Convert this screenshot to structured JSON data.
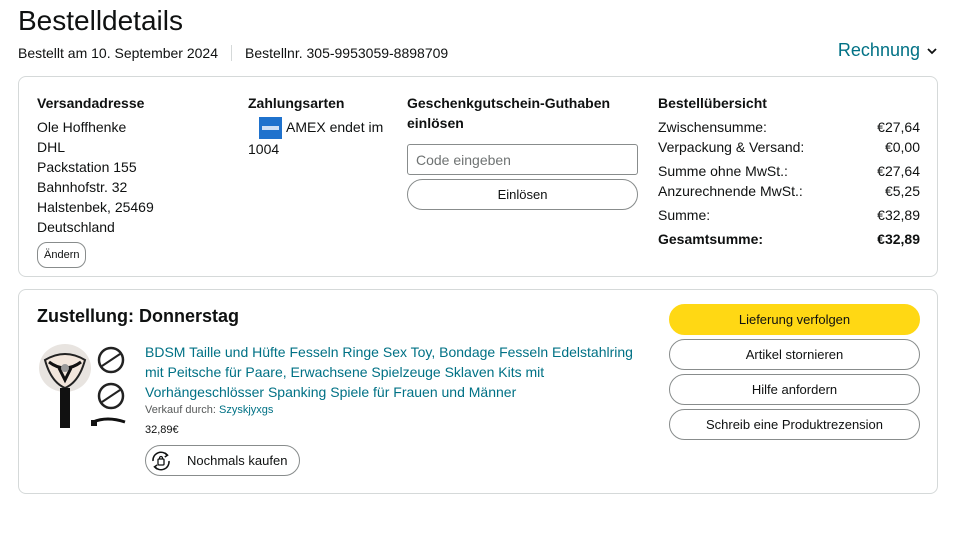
{
  "header": {
    "title": "Bestelldetails",
    "order_date": "Bestellt am 10. September 2024",
    "order_number": "Bestellnr. 305-9953059-8898709",
    "invoice_label": "Rechnung"
  },
  "address": {
    "heading": "Versandadresse",
    "lines": [
      "Ole Hoffhenke",
      "DHL",
      "Packstation 155",
      "Bahnhofstr. 32",
      "Halstenbek, 25469",
      "Deutschland"
    ],
    "change_label": "Ändern"
  },
  "payment": {
    "heading": "Zahlungsarten",
    "card_text": "AMEX endet im",
    "card_digits": "1004",
    "card_icon": "amex-card-icon"
  },
  "gift": {
    "heading": "Geschenkgutschein-Guthaben einlösen",
    "input_placeholder": "Code eingeben",
    "redeem_label": "Einlösen"
  },
  "summary": {
    "heading": "Bestellübersicht",
    "rows": [
      {
        "label": "Zwischensumme:",
        "value": "€27,64"
      },
      {
        "label": "Verpackung & Versand:",
        "value": "€0,00"
      },
      {
        "label": "Summe ohne MwSt.:",
        "value": "€27,64"
      },
      {
        "label": "Anzurechnende MwSt.:",
        "value": "€5,25"
      },
      {
        "label": "Summe:",
        "value": "€32,89"
      },
      {
        "label": "Gesamtsumme:",
        "value": "€32,89"
      }
    ]
  },
  "delivery": {
    "title": "Zustellung: Donnerstag",
    "product_title": "BDSM Taille und Hüfte Fesseln Ringe Sex Toy, Bondage Fesseln Edelstahlring mit Peitsche für Paare, Erwachsene Spielzeuge Sklaven Kits mit Vorhängeschlösser Spanking Spiele für Frauen und Männer",
    "seller_prefix": "Verkauf durch:",
    "seller_name": "Szyskjyxgs",
    "price": "32,89€",
    "rebuy_label": "Nochmals kaufen"
  },
  "actions": {
    "track": "Lieferung verfolgen",
    "cancel": "Artikel stornieren",
    "help": "Hilfe anfordern",
    "review": "Schreib eine Produktrezension"
  },
  "colors": {
    "link": "#007185",
    "primary_button": "#ffd814",
    "border": "#d5d9d9",
    "amex": "#1f72cd"
  }
}
